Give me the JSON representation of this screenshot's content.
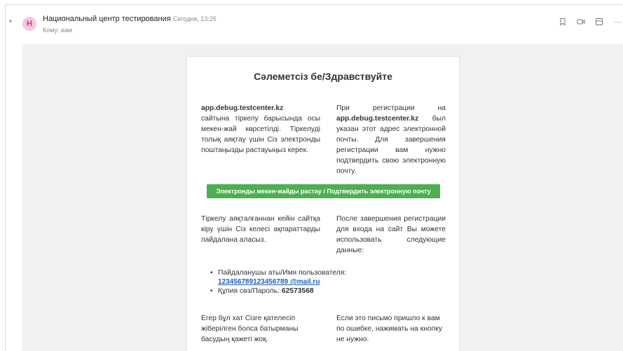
{
  "header": {
    "avatar_letter": "Н",
    "sender": "Национальный центр тестирования",
    "time": "Сегодня, 13:25",
    "to": "Кому: вам"
  },
  "toolbar": {
    "more_label": "···"
  },
  "letter": {
    "title": "Сәлеметсіз бе/Здравствуйте",
    "kz_intro_site": "app.debug.testcenter.kz",
    "kz_intro_rest": "сайтына тіркелу барысында осы мекен-жай көрсетілді. Тіркелуді толық аяқтау үшін Сіз электронды поштаңызды растауыңыз керек.",
    "ru_intro_before": "При регистрации на",
    "ru_intro_site": "app.debug.testcenter.kz",
    "ru_intro_after": "был указан этот адрес электронной почты. Для завершения регистрации вам нужно подтвердить свою электронную почту.",
    "confirm_button": "Электронды мекен-жайды растау / Подтвердить электронную почту",
    "kz_after": "Тіркелу аяқталғаннан кейін сайтқа кіру үшін Сіз келесі ақпараттарды пайдалана аласыз.",
    "ru_after": "После завершения регистрации для входа на сайт Вы можете использовать следующие данные:",
    "username_label": "Пайдаланушы аты/Имя пользователя:",
    "username_value": "123456789123456789 @mail.ru",
    "password_label": "Құпия сөз/Пароль:",
    "password_value": "62573568",
    "kz_footer": "Егер бұл хат Сізге қателесіп жіберілген болса батырманы басудың қажеті жоқ.",
    "ru_footer": "Если это письмо пришло к вам по ошибке, нажимать на кнопку не нужно."
  },
  "colors": {
    "button": "#4caf50",
    "link": "#1a5fd0",
    "avatar_bg": "#f7c6e0",
    "avatar_fg": "#d0368a"
  }
}
